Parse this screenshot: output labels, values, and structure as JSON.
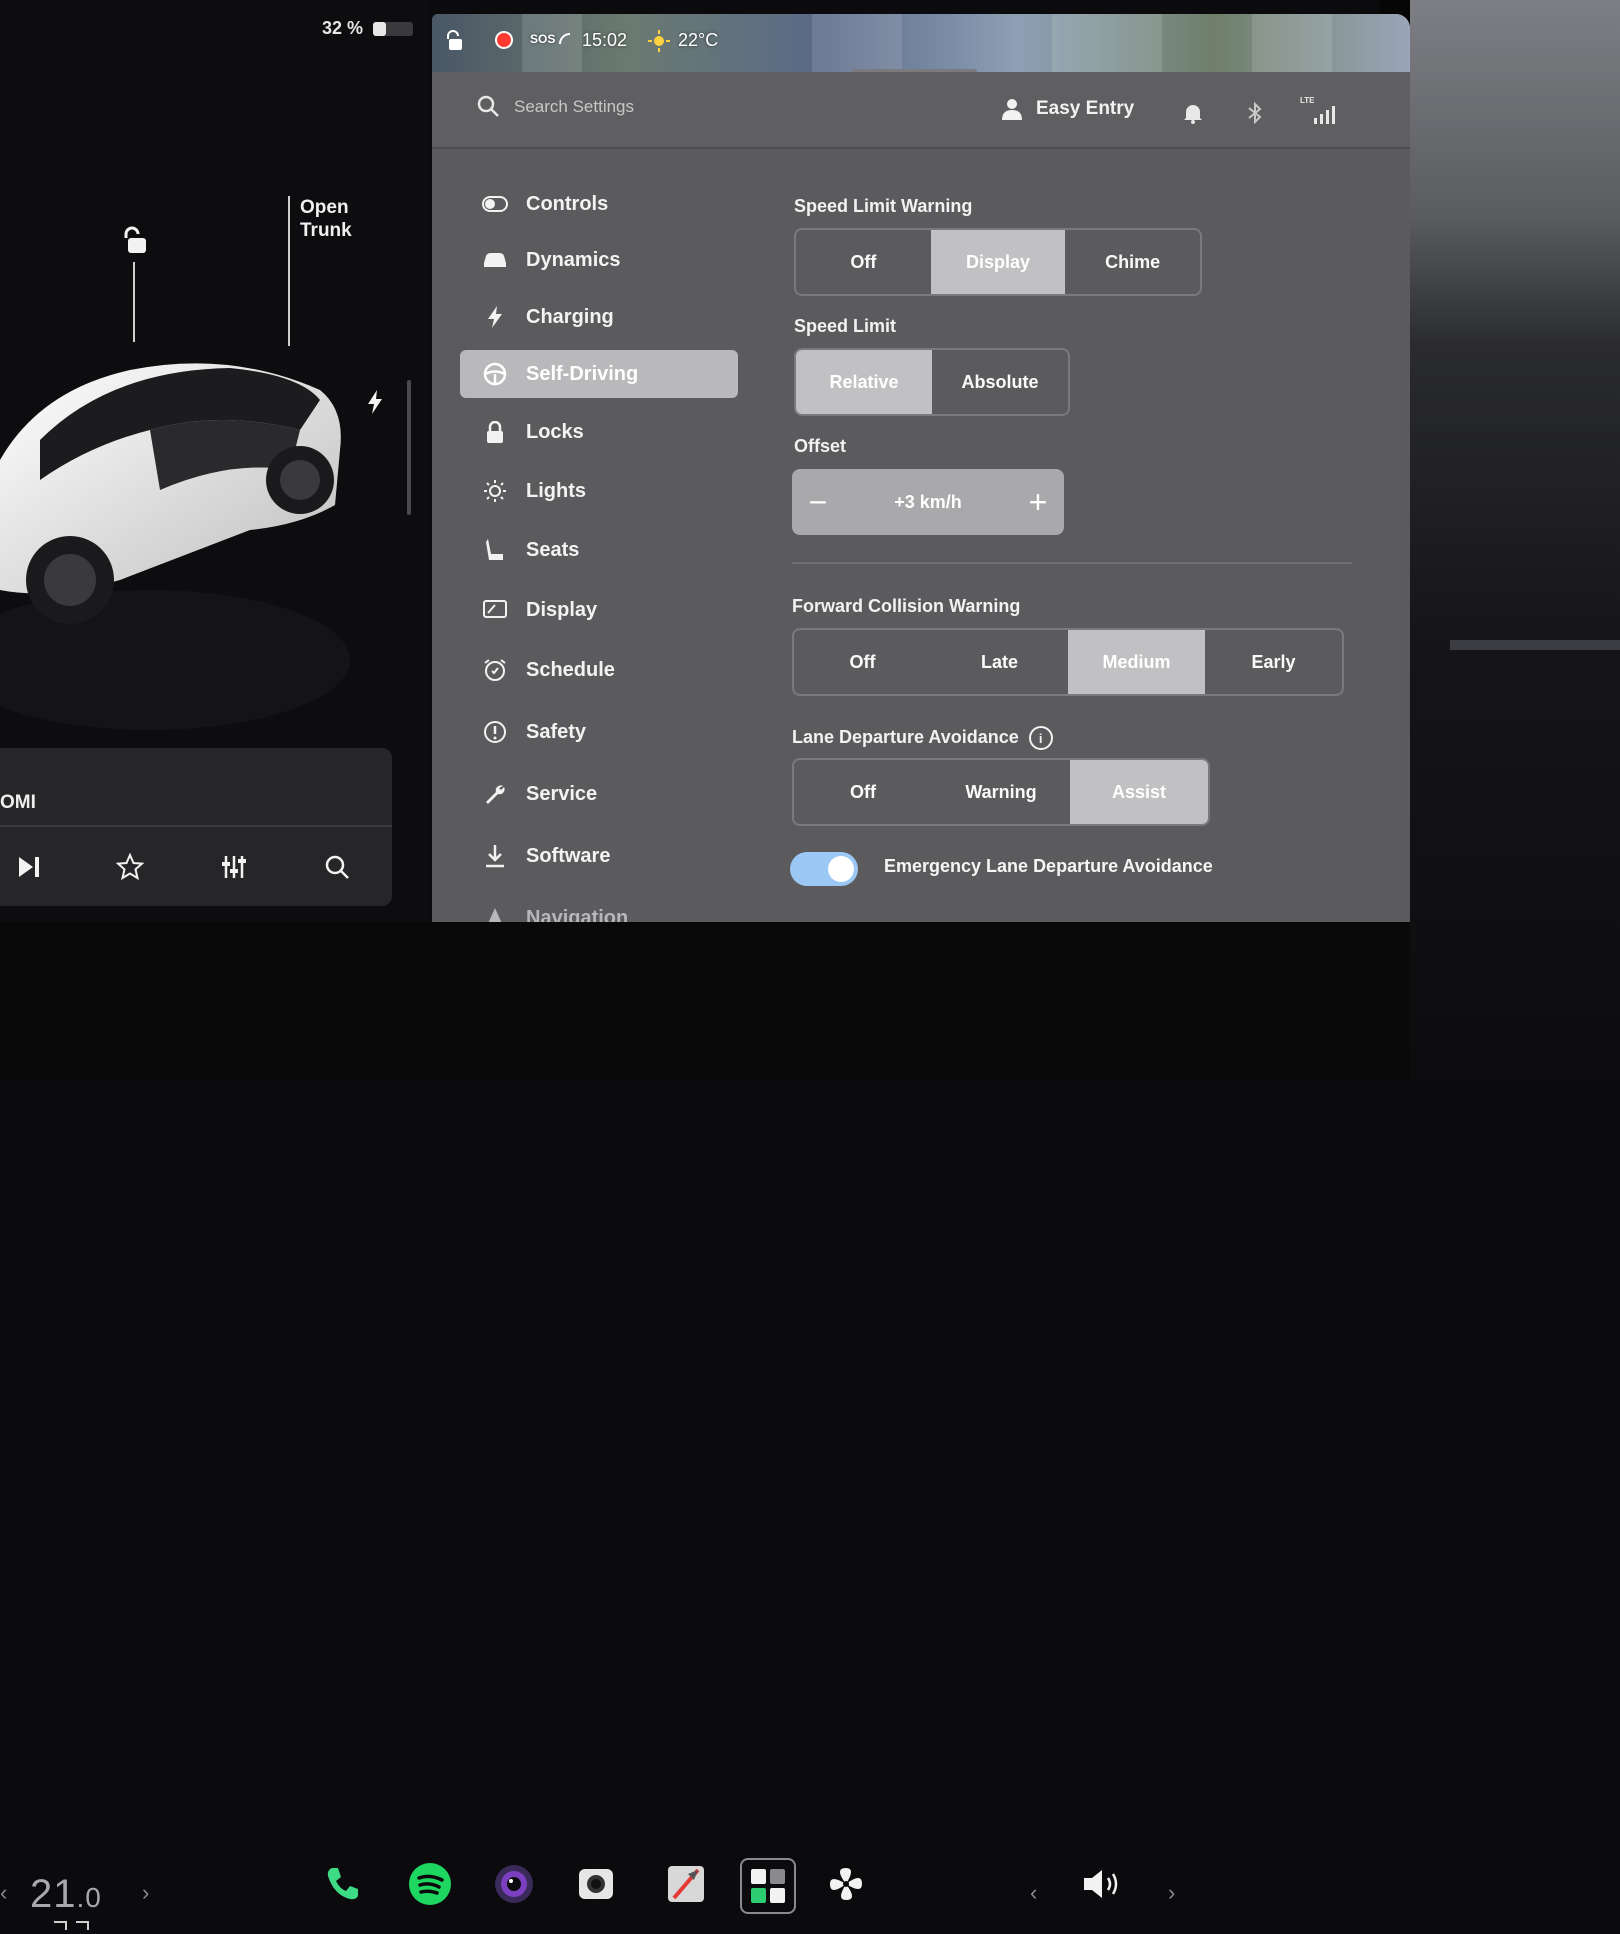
{
  "status": {
    "battery_percent": "32 %",
    "battery_level": 0.32,
    "sos": "SOS",
    "time": "15:02",
    "temperature": "22°C"
  },
  "car": {
    "trunk_line1": "Open",
    "trunk_line2": "Trunk"
  },
  "media": {
    "source": "OMI"
  },
  "header": {
    "search_placeholder": "Search Settings",
    "profile_name": "Easy Entry",
    "lte": "LTE"
  },
  "nav": {
    "items": [
      {
        "label": "Controls",
        "icon": "toggle-icon"
      },
      {
        "label": "Dynamics",
        "icon": "car-icon"
      },
      {
        "label": "Charging",
        "icon": "bolt-icon"
      },
      {
        "label": "Self-Driving",
        "icon": "steering-wheel-icon",
        "active": true
      },
      {
        "label": "Locks",
        "icon": "lock-icon"
      },
      {
        "label": "Lights",
        "icon": "sun-icon"
      },
      {
        "label": "Seats",
        "icon": "seat-icon"
      },
      {
        "label": "Display",
        "icon": "display-icon"
      },
      {
        "label": "Schedule",
        "icon": "alarm-icon"
      },
      {
        "label": "Safety",
        "icon": "alert-icon"
      },
      {
        "label": "Service",
        "icon": "wrench-icon"
      },
      {
        "label": "Software",
        "icon": "download-icon"
      },
      {
        "label": "Navigation",
        "icon": "navigation-icon"
      }
    ]
  },
  "self_driving": {
    "speed_limit_warning": {
      "title": "Speed Limit Warning",
      "options": [
        "Off",
        "Display",
        "Chime"
      ],
      "selected": "Display"
    },
    "speed_limit": {
      "title": "Speed Limit",
      "options": [
        "Relative",
        "Absolute"
      ],
      "selected": "Relative"
    },
    "offset": {
      "title": "Offset",
      "value": "+3 km/h",
      "minus": "−",
      "plus": "+"
    },
    "forward_collision_warning": {
      "title": "Forward Collision Warning",
      "options": [
        "Off",
        "Late",
        "Medium",
        "Early"
      ],
      "selected": "Medium"
    },
    "lane_departure_avoidance": {
      "title": "Lane Departure Avoidance",
      "info": "i",
      "options": [
        "Off",
        "Warning",
        "Assist"
      ],
      "selected": "Assist"
    },
    "emergency_lane_departure": {
      "label": "Emergency Lane Departure Avoidance",
      "enabled": true
    }
  },
  "dock": {
    "temperature_whole": "21",
    "temperature_decimal": ".0",
    "left_chevron": "‹",
    "right_chevron": "›",
    "apps": [
      "phone-icon",
      "spotify-icon",
      "camera-lens-icon",
      "dashcam-icon",
      "navigation-app-icon",
      "apps-grid-icon",
      "fan-icon"
    ],
    "vol_left": "‹",
    "vol_right": "›"
  },
  "colors": {
    "panel_bg": "#5b5b5e",
    "selected_option": "#c1c1c3",
    "toggle_on": "#9cc8f5",
    "spotify": "#1ed760",
    "phone": "#3ddc84"
  }
}
